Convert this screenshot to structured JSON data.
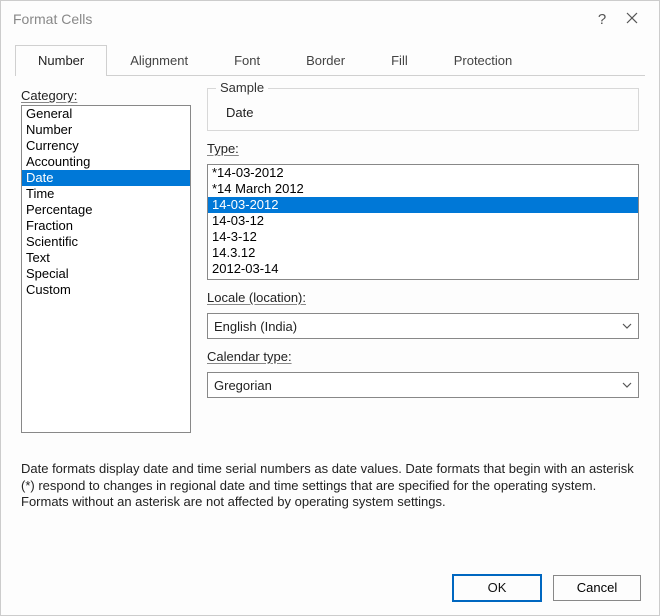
{
  "window": {
    "title": "Format Cells"
  },
  "tabs": {
    "items": [
      "Number",
      "Alignment",
      "Font",
      "Border",
      "Fill",
      "Protection"
    ],
    "active_index": 0
  },
  "category": {
    "label": "Category:",
    "items": [
      "General",
      "Number",
      "Currency",
      "Accounting",
      "Date",
      "Time",
      "Percentage",
      "Fraction",
      "Scientific",
      "Text",
      "Special",
      "Custom"
    ],
    "selected_index": 4
  },
  "sample": {
    "label": "Sample",
    "value": "Date"
  },
  "type": {
    "label": "Type:",
    "items": [
      "*14-03-2012",
      "*14 March 2012",
      "14-03-2012",
      "14-03-12",
      "14-3-12",
      "14.3.12",
      "2012-03-14"
    ],
    "selected_index": 2
  },
  "locale": {
    "label": "Locale (location):",
    "value": "English (India)"
  },
  "calendar": {
    "label": "Calendar type:",
    "value": "Gregorian"
  },
  "description": "Date formats display date and time serial numbers as date values.  Date formats that begin with an asterisk (*) respond to changes in regional date and time settings that are specified for the operating system. Formats without an asterisk are not affected by operating system settings.",
  "buttons": {
    "ok": "OK",
    "cancel": "Cancel"
  }
}
